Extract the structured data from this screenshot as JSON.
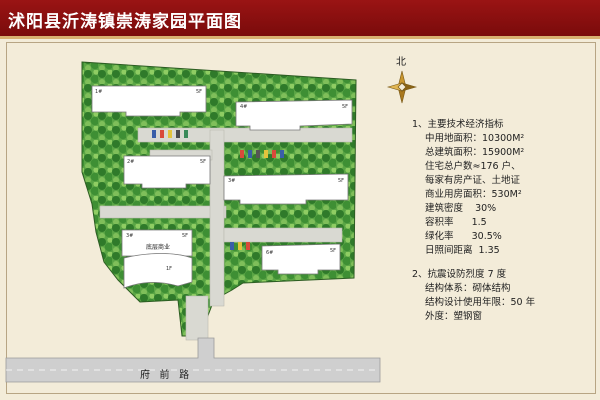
{
  "title": "沭阳县沂涛镇崇涛家园平面图",
  "north_label": "北",
  "road_label": "府   前   路",
  "buildings": {
    "b1": {
      "left": "1#",
      "right": "5F"
    },
    "b2": {
      "left": "4#",
      "right": "5F"
    },
    "b3": {
      "left": "2#",
      "right": "5F"
    },
    "b4": {
      "left": "3#",
      "right": "5F"
    },
    "b5": {
      "left": "3#",
      "right": "5F",
      "name": "底层商业",
      "floor": "1F"
    },
    "b6": {
      "left": "6#",
      "right": "5F"
    }
  },
  "legend": {
    "section1_title": "1、主要技术经济指标",
    "items": [
      "中用地面积：10300M²",
      "总建筑面积：15900M²",
      "住宅总户数≈176 户、",
      "每家有房产证、土地证",
      "商业用房面积：530M²",
      "建筑密度    30%",
      "容积率      1.5",
      "绿化率      30.5%",
      "日照间距离  1.35"
    ],
    "section2_title": "2、抗震设防烈度 7 度",
    "items2": [
      "结构体系：砌体结构",
      "结构设计使用年限：50 年",
      "外度：塑钢窗"
    ]
  },
  "colors": {
    "title_bg": "#8b0f0f",
    "green": "#4f9a3a",
    "building": "#ffffff",
    "road": "#c9c9c9",
    "compass": "#c9962e"
  }
}
